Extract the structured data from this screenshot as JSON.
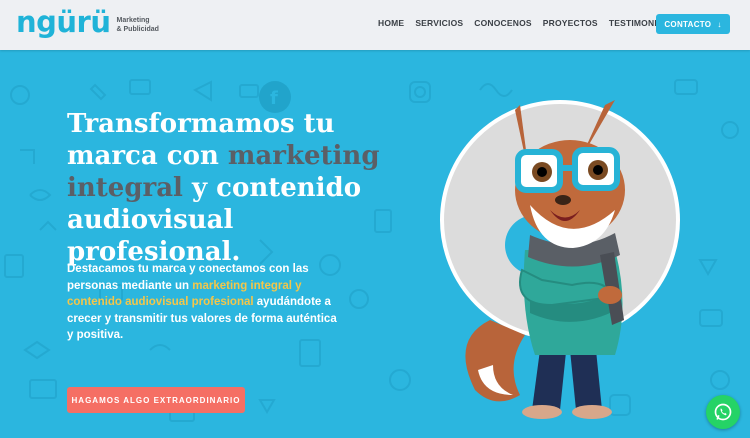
{
  "brand": {
    "name": "ngürü",
    "tagline_line1": "Marketing",
    "tagline_line2": "& Publicidad"
  },
  "nav": {
    "items": [
      "HOME",
      "SERVICIOS",
      "CONOCENOS",
      "PROYECTOS",
      "TESTIMONIOS"
    ],
    "contact_label": "CONTACTO"
  },
  "hero": {
    "title_part1": "Transformamos tu marca con ",
    "title_highlight": "marketing integral",
    "title_part2": " y contenido audiovisual profesional.",
    "text_part1": "Destacamos tu marca y conectamos con las personas mediante un ",
    "text_highlight": "marketing integral y contenido audiovisual profesional",
    "text_part2": " ayudándote a crecer y transmitir tus valores de forma auténtica y positiva.",
    "cta_label": "HAGAMOS ALGO EXTRAORDINARIO"
  },
  "colors": {
    "primary": "#2bb6df",
    "cta": "#f56f64",
    "highlight_title": "#5b5f66",
    "highlight_text": "#f3c64a",
    "whatsapp": "#25d366"
  },
  "icons": {
    "contact_arrow": "arrow-down-icon",
    "floating": "whatsapp-icon",
    "mascot": "fox-mascot-illustration"
  }
}
